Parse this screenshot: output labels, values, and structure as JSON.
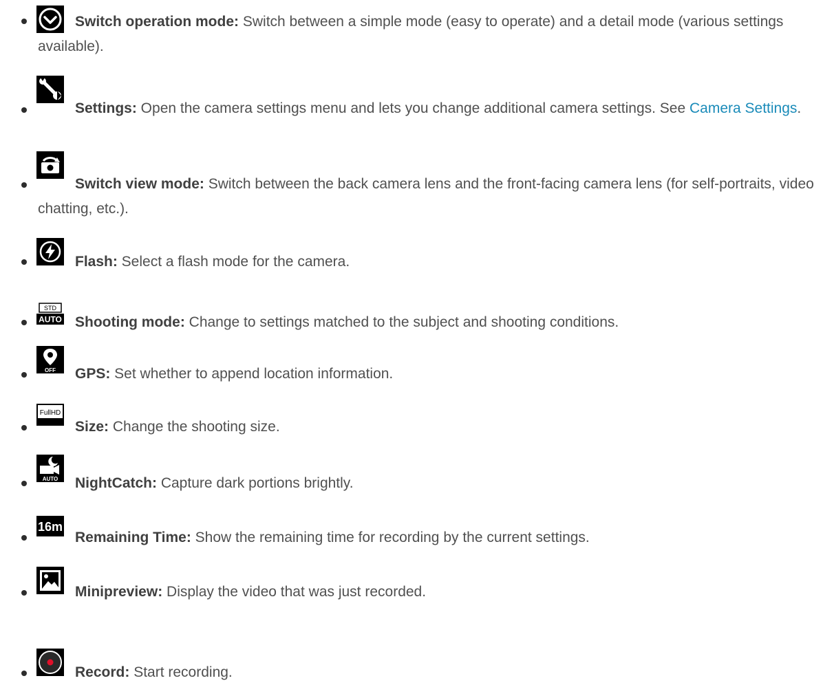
{
  "items": [
    {
      "icon": "switch-operation-mode-icon",
      "term": "Switch operation mode:",
      "desc": " Switch between a simple mode (easy to operate) and a detail mode (various settings available)."
    },
    {
      "icon": "settings-wrench-icon",
      "term": "Settings:",
      "desc": " Open the camera settings menu and lets you change additional camera settings. See ",
      "link": "Camera Settings",
      "after": "."
    },
    {
      "icon": "switch-view-mode-icon",
      "term": "Switch view mode:",
      "desc": " Switch between the back camera lens and the front-facing camera lens (for self-portraits, video chatting, etc.)."
    },
    {
      "icon": "flash-icon",
      "term": "Flash:",
      "desc": " Select a flash mode for the camera."
    },
    {
      "icon": "shooting-mode-icon",
      "icon_text": [
        "STD",
        "AUTO"
      ],
      "term": "Shooting mode:",
      "desc": " Change to settings matched to the subject and shooting conditions."
    },
    {
      "icon": "gps-icon",
      "icon_text": [
        "OFF"
      ],
      "term": "GPS:",
      "desc": " Set whether to append location information."
    },
    {
      "icon": "size-icon",
      "icon_text": [
        "FullHD"
      ],
      "term": "Size:",
      "desc": " Change the shooting size."
    },
    {
      "icon": "nightcatch-icon",
      "icon_text": [
        "AUTO"
      ],
      "term": "NightCatch:",
      "desc": " Capture dark portions brightly."
    },
    {
      "icon": "remaining-time-icon",
      "icon_text": [
        "16m"
      ],
      "term": "Remaining Time:",
      "desc": " Show the remaining time for recording by the current settings."
    },
    {
      "icon": "minipreview-icon",
      "term": "Minipreview:",
      "desc": " Display the video that was just recorded."
    },
    {
      "icon": "record-icon",
      "term": "Record:",
      "desc": " Start recording."
    }
  ]
}
